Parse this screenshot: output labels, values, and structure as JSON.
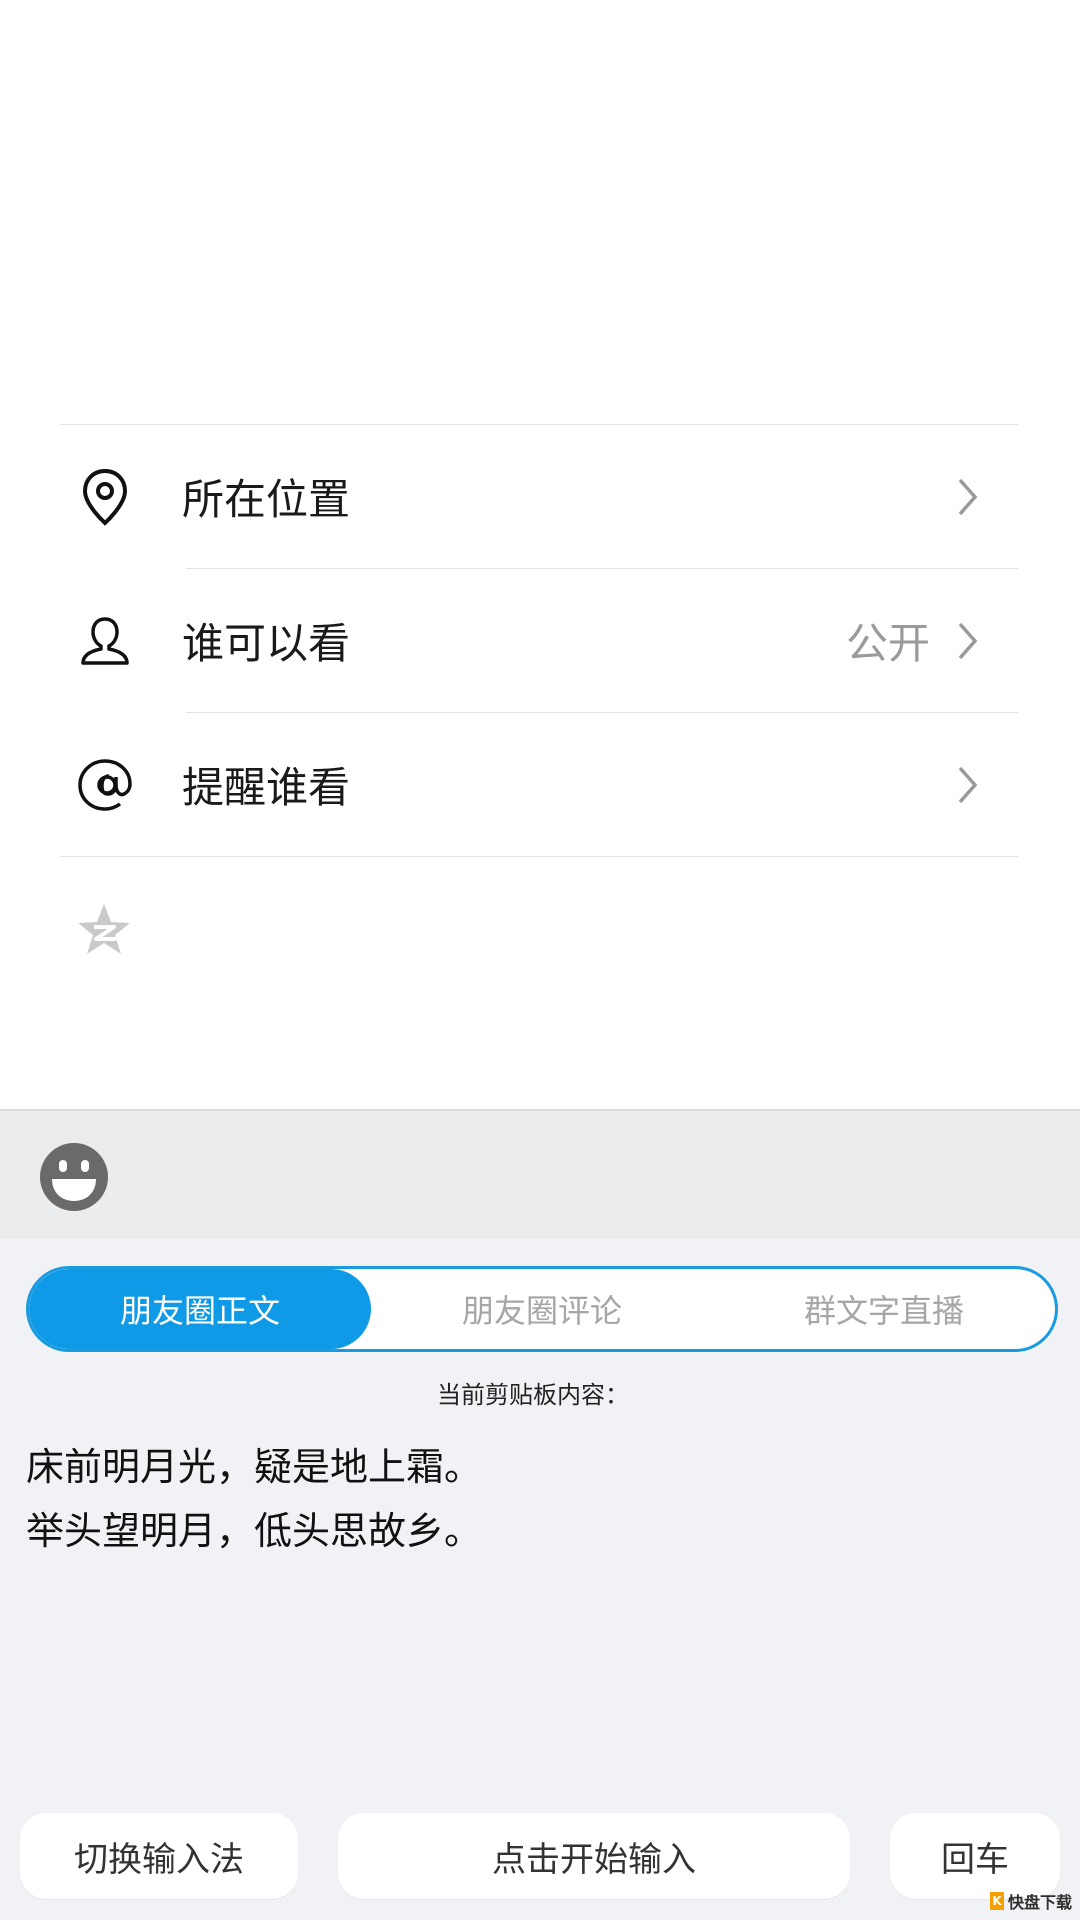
{
  "settings": {
    "items": [
      {
        "label": "所在位置",
        "value": ""
      },
      {
        "label": "谁可以看",
        "value": "公开"
      },
      {
        "label": "提醒谁看",
        "value": ""
      }
    ]
  },
  "keyboard": {
    "tabs": [
      {
        "label": "朋友圈正文",
        "active": true
      },
      {
        "label": "朋友圈评论",
        "active": false
      },
      {
        "label": "群文字直播",
        "active": false
      }
    ],
    "clipboard_title": "当前剪贴板内容：",
    "clipboard_text": "床前明月光，疑是地上霜。\n举头望明月，低头思故乡。",
    "buttons": {
      "switch_ime": "切换输入法",
      "start_input": "点击开始输入",
      "enter": "回车"
    }
  },
  "watermark": {
    "text": "快盘下载"
  },
  "colors": {
    "accent": "#0e9ae6",
    "panel_bg": "#f0f2f5"
  }
}
